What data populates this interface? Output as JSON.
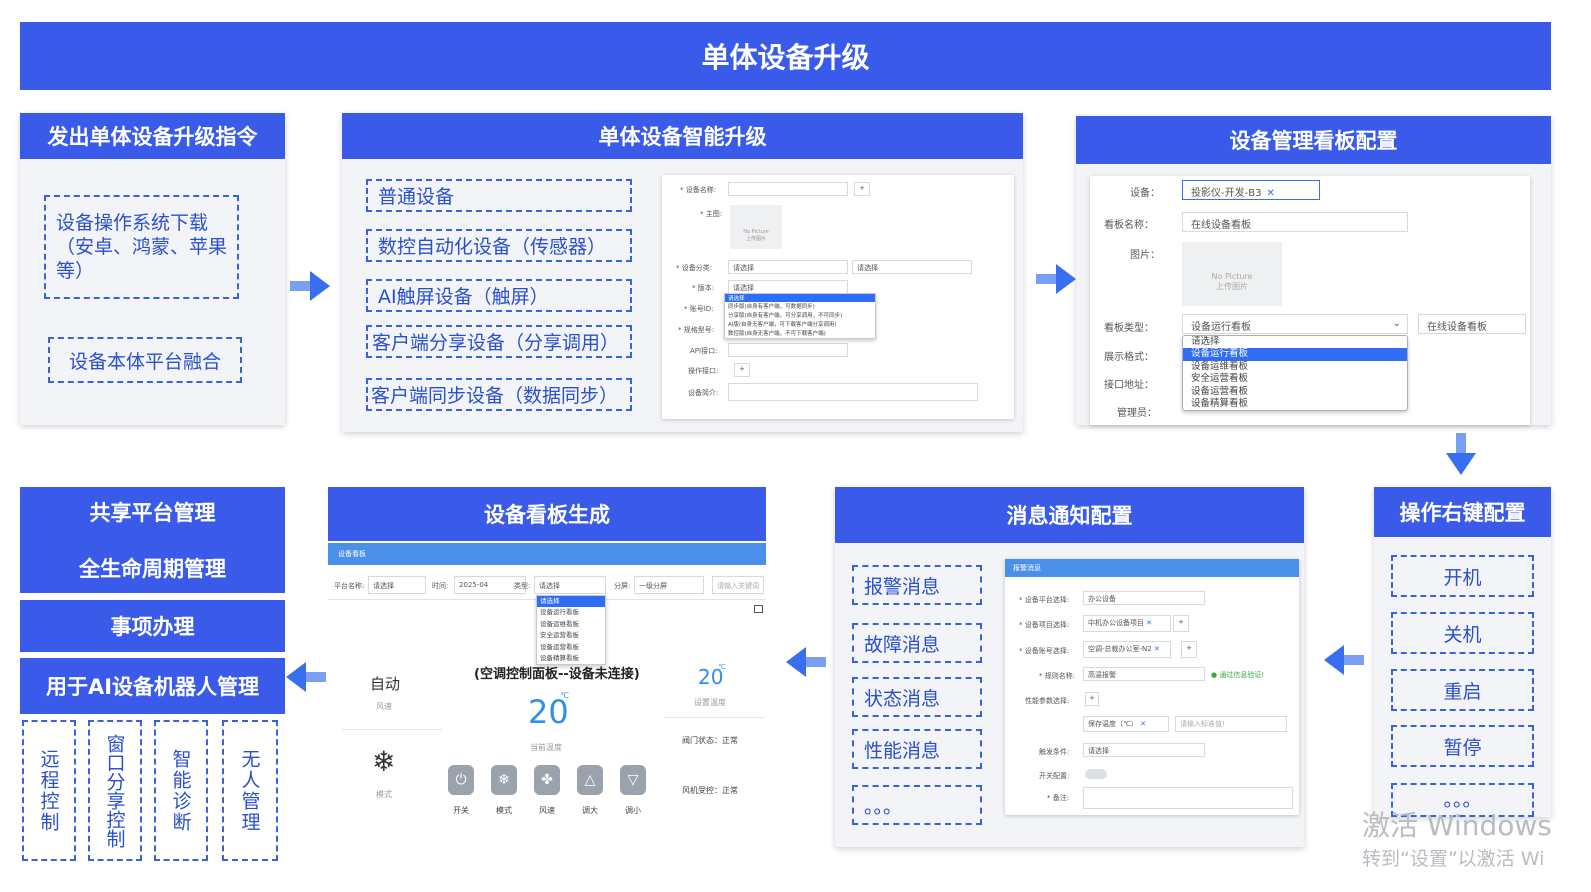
{
  "title": "单体设备升级",
  "panel1": {
    "header": "发出单体设备升级指令",
    "items": [
      "设备操作系统下载（安卓、鸿蒙、苹果等）",
      "设备本体平台融合"
    ]
  },
  "panel2": {
    "header": "单体设备智能升级",
    "items": [
      "普通设备",
      "数控自动化设备（传感器）",
      "AI触屏设备（触屏）",
      "客户端分享设备（分享调用）",
      "客户端同步设备（数据同步）"
    ],
    "form": {
      "labels": [
        "* 设备名称:",
        "* 主图:",
        "* 设备分类:",
        "* 版本:",
        "* 账号ID:",
        "* 规格型号:",
        "API接口:",
        "操作接口:",
        "设备简介:"
      ],
      "no_picture": "No Picture",
      "upload": "上传图片",
      "select_placeholder": "请选择",
      "dropdown": [
        "请选择",
        "同步版(自身有客户端，可数据同步)",
        "分享版(自身有客户端，可分享调用，不可同步)",
        "AI版(自身无客户端，可下载客户端分享调用)",
        "数控版(自身无客户端，不可下载客户端)"
      ]
    }
  },
  "panel3": {
    "header": "设备管理看板配置",
    "labels": [
      "设备：",
      "看板名称：",
      "图片：",
      "看板类型：",
      "展示格式：",
      "接口地址：",
      "管理员："
    ],
    "device_tag": "投影仪-开发-B3",
    "board_name": "在线设备看板",
    "no_picture": "No Picture",
    "upload": "上传图片",
    "board_type": "设备运行看板",
    "side_value": "在线设备看板",
    "dropdown": [
      "请选择",
      "设备运行看板",
      "设备运维看板",
      "安全运营看板",
      "设备运营看板",
      "设备精算看板"
    ]
  },
  "panel4": {
    "header": "操作右键配置",
    "items": [
      "开机",
      "关机",
      "重启",
      "暂停",
      "。。。"
    ]
  },
  "panel5": {
    "header": "消息通知配置",
    "items": [
      "报警消息",
      "故障消息",
      "状态消息",
      "性能消息",
      "。。。"
    ],
    "form": {
      "title": "报警消息",
      "labels": [
        "* 设备平台选择:",
        "* 设备项目选择:",
        "* 设备账号选择:",
        "* 规则名称:",
        "性能参数选择:",
        "触发条件:",
        "开关配置:",
        "* 备注:"
      ],
      "platform": "办公设备",
      "project_tag": "中机办公设备项目",
      "account_tag": "空调-总裁办公室-N2",
      "rule_name": "高温报警",
      "verified": "通过信息验证!",
      "param_tag": "保存温度（℃）",
      "param_placeholder": "请输入标准值!",
      "trigger": "请选择"
    }
  },
  "panel6": {
    "header": "设备看板生成",
    "topbar": "设备看板",
    "filters": {
      "platform_label": "平台名称:",
      "platform_value": "请选择",
      "time_label": "时间:",
      "time_value": "2025-04",
      "type_label": "类型:",
      "type_value": "请选择",
      "screen_label": "分屏:",
      "screen_value": "一级分屏",
      "search_placeholder": "请输入关键词"
    },
    "type_dropdown": [
      "请选择",
      "设备运行看板",
      "设备运维看板",
      "安全运营看板",
      "设备运营看板",
      "设备精算看板"
    ],
    "mode_auto": "自动",
    "wind_label": "风速",
    "mode_label": "模式",
    "panel_title": "(空调控制面板--设备未连接)",
    "current_temp": "20",
    "temp_unit": "℃",
    "current_label": "当前温度",
    "set_temp": "20",
    "set_label": "设置温度",
    "valve": "阀门状态：正常",
    "fan": "风机受控：正常",
    "controls": [
      "开关",
      "模式",
      "风速",
      "调大",
      "调小"
    ]
  },
  "panel7": {
    "headers": [
      "共享平台管理",
      "全生命周期管理",
      "事项办理",
      "用于AI设备机器人管理"
    ],
    "items": [
      "远程控制",
      "窗口分享控制",
      "智能诊断",
      "无人管理"
    ]
  },
  "watermark": {
    "line1": "激活 Windows",
    "line2": "转到“设置”以激活 Wi"
  }
}
